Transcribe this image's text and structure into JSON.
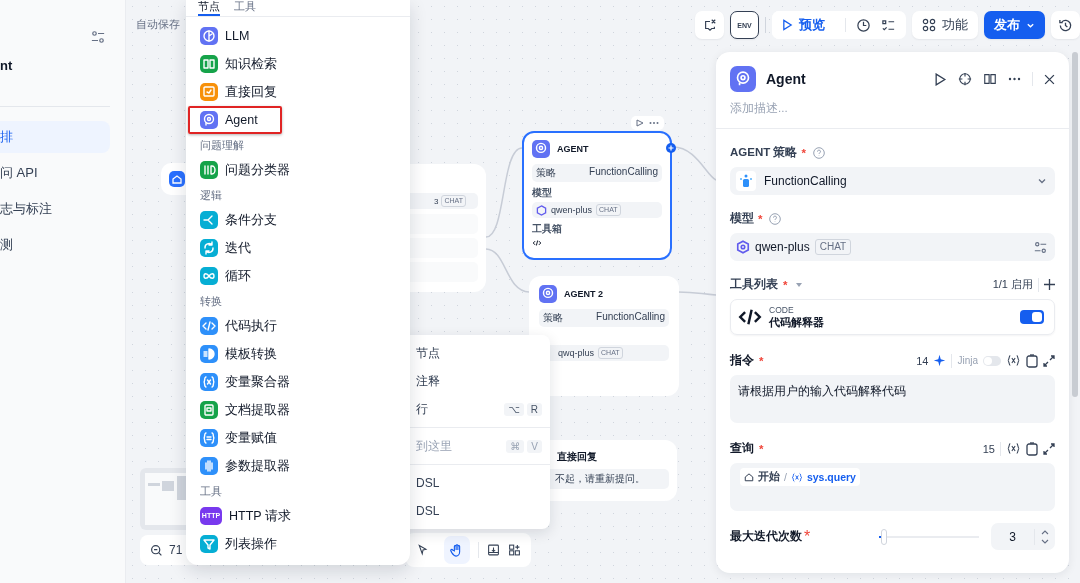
{
  "sidebar": {
    "title": "nt",
    "items": [
      {
        "label": "排",
        "selected": true
      },
      {
        "label": "问 API",
        "selected": false
      },
      {
        "label": "志与标注",
        "selected": false
      },
      {
        "label": "测",
        "selected": false
      }
    ]
  },
  "autosave": "自动保存",
  "node_menu": {
    "tabs": [
      {
        "label": "节点",
        "selected": true
      },
      {
        "label": "工具",
        "selected": false
      }
    ],
    "groups": [
      {
        "items": [
          {
            "label": "LLM",
            "color": "#6172f3",
            "marked": false
          },
          {
            "label": "知识检索",
            "color": "#16a34a",
            "marked": false
          },
          {
            "label": "直接回复",
            "color": "#f79009",
            "marked": false
          },
          {
            "label": "Agent",
            "color": "#6172f3",
            "marked": true
          }
        ]
      },
      {
        "heading": "问题理解",
        "items": [
          {
            "label": "问题分类器",
            "color": "#16a34a",
            "marked": false
          }
        ]
      },
      {
        "heading": "逻辑",
        "items": [
          {
            "label": "条件分支",
            "color": "#06aed4",
            "marked": false
          },
          {
            "label": "迭代",
            "color": "#06aed4",
            "marked": false
          },
          {
            "label": "循环",
            "color": "#06aed4",
            "marked": false
          }
        ]
      },
      {
        "heading": "转换",
        "items": [
          {
            "label": "代码执行",
            "color": "#2e90fa",
            "marked": false
          },
          {
            "label": "模板转换",
            "color": "#2e90fa",
            "marked": false
          },
          {
            "label": "变量聚合器",
            "color": "#2e90fa",
            "marked": false
          },
          {
            "label": "文档提取器",
            "color": "#16a34a",
            "marked": false
          },
          {
            "label": "变量赋值",
            "color": "#2e90fa",
            "marked": false
          },
          {
            "label": "参数提取器",
            "color": "#2e90fa",
            "marked": false
          }
        ]
      },
      {
        "heading": "工具",
        "items": [
          {
            "label": "HTTP 请求",
            "color": "#7839ee",
            "marked": false,
            "icon_text": "HTTP"
          },
          {
            "label": "列表操作",
            "color": "#06aed4",
            "marked": false
          }
        ]
      }
    ]
  },
  "canvas": {
    "partial_node": {
      "model_tail": "3",
      "tag": "CHAT"
    },
    "agent_nodes": [
      {
        "title": "AGENT",
        "selected": true,
        "strategy_label": "策略",
        "strategy": "FunctionCalling",
        "model_label": "模型",
        "model": "qwen-plus",
        "tag": "CHAT",
        "tools_label": "工具箱"
      },
      {
        "title": "AGENT 2",
        "selected": false,
        "strategy_label": "策略",
        "strategy": "FunctionCalling",
        "model": "qwq-plus",
        "tag": "CHAT"
      }
    ],
    "answer_node": {
      "title": "直接回复",
      "text": "不起，请重新提问。"
    },
    "zoom": "71",
    "tools": [
      {
        "selected": false
      },
      {
        "selected": true
      }
    ]
  },
  "context_menu": [
    {
      "label": "节点",
      "disabled": false
    },
    {
      "label": "注释",
      "disabled": false
    },
    {
      "label": "行",
      "disabled": false,
      "keys": [
        "⌥",
        "R"
      ]
    },
    {
      "label": "到这里",
      "disabled": true,
      "keys": [
        "⌘",
        "V"
      ]
    },
    {
      "label": "DSL",
      "disabled": false
    },
    {
      "label": "DSL",
      "disabled": false
    }
  ],
  "top_bar": {
    "env": "ENV",
    "preview": "预览",
    "features": "功能",
    "publish": "发布"
  },
  "panel": {
    "title": "Agent",
    "description_placeholder": "添加描述...",
    "strategy": {
      "label": "AGENT 策略",
      "required_mark": "*",
      "value": "FunctionCalling"
    },
    "model": {
      "label": "模型",
      "required_mark": "*",
      "value": "qwen-plus",
      "tag": "CHAT"
    },
    "tools": {
      "label": "工具列表",
      "required_mark": "*",
      "count": "1/1 启用",
      "items": [
        {
          "provider": "CODE",
          "name": "代码解释器",
          "on": true
        }
      ]
    },
    "instruction": {
      "label": "指令",
      "required_mark": "*",
      "count": "14",
      "jinja": {
        "label": "Jinja",
        "on": false
      },
      "value": "请根据用户的输入代码解释代码"
    },
    "query": {
      "label": "查询",
      "required_mark": "*",
      "count": "15",
      "node": "开始",
      "separator": "/",
      "variable": "sys.query"
    },
    "max_iterations": {
      "label": "最大迭代次数",
      "required_mark": "*",
      "level": 0.05,
      "value": "3"
    }
  }
}
